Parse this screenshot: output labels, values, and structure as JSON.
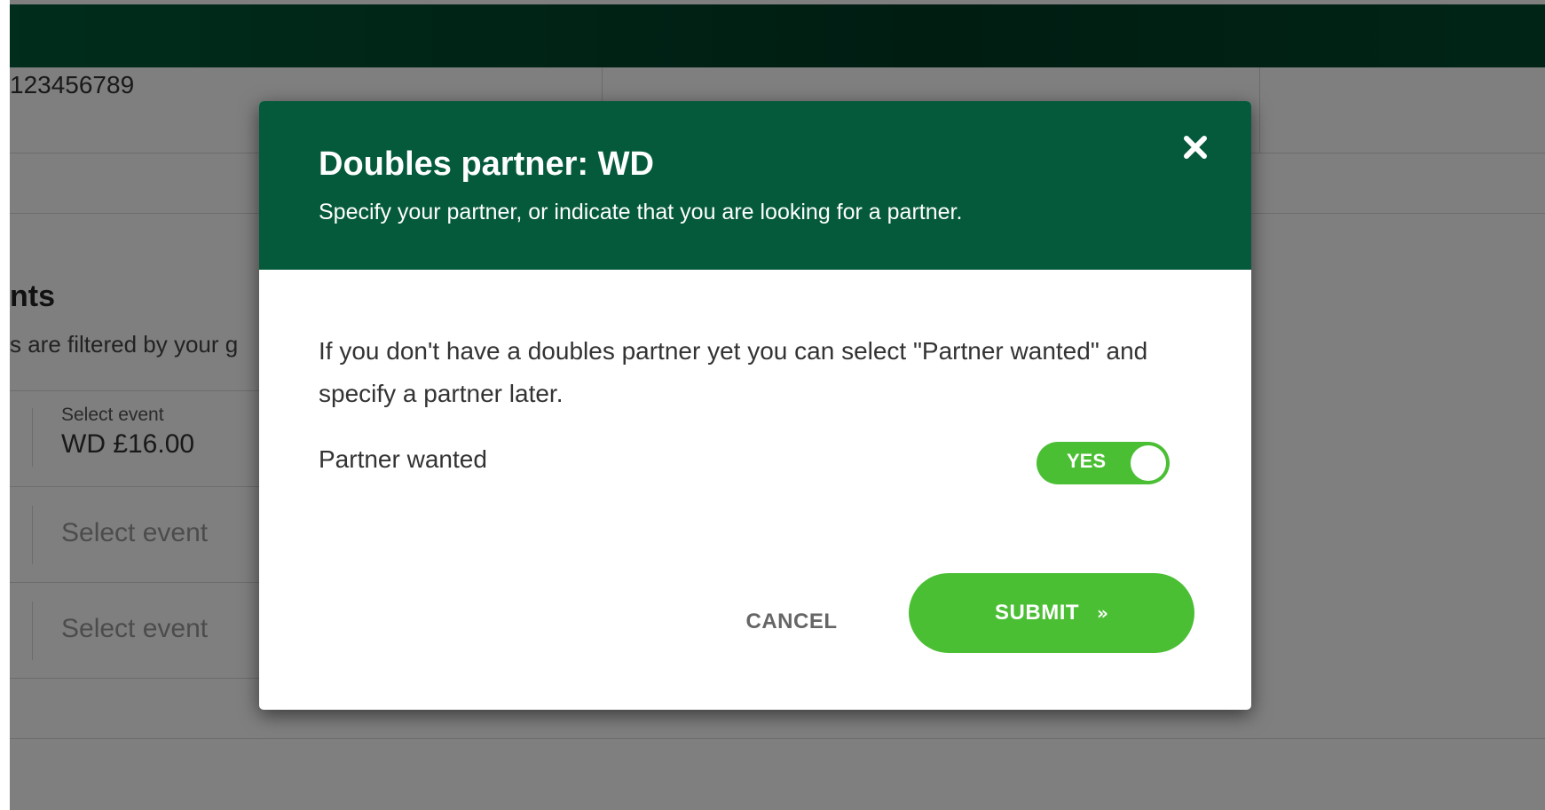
{
  "background": {
    "member_id": "123456789",
    "section_title": "nts",
    "section_subtitle": "s are filtered by your g",
    "events": [
      {
        "label": "Select event",
        "value": "WD £16.00"
      },
      {
        "placeholder": "Select event"
      },
      {
        "placeholder": "Select event"
      }
    ]
  },
  "modal": {
    "title": "Doubles partner: WD",
    "subtitle": "Specify your partner, or indicate that you are looking for a partner.",
    "close_icon": "close-icon",
    "body_text": "If you don't have a doubles partner yet you can select \"Partner wanted\" and specify a partner later.",
    "partner_wanted_label": "Partner wanted",
    "toggle": {
      "label": "YES",
      "state": true
    },
    "cancel_label": "CANCEL",
    "submit_label": "SUBMIT",
    "submit_chevron": "»"
  },
  "colors": {
    "header_green": "#045a3b",
    "topbar_dark_green": "#003a24",
    "accent_green": "#4bbf34",
    "overlay": "rgba(0,0,0,0.5)"
  }
}
